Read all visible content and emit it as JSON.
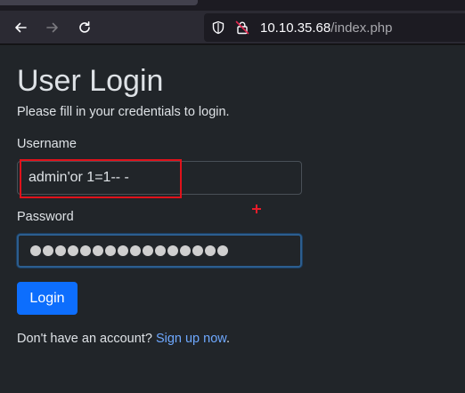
{
  "browser": {
    "url_host": "10.10.35.68",
    "url_path": "/index.php"
  },
  "page": {
    "title": "User Login",
    "subtitle": "Please fill in your credentials to login.",
    "username_label": "Username",
    "username_value": "admin'or 1=1-- -",
    "password_label": "Password",
    "password_masked_char_count": 16,
    "login_button": "Login",
    "footer_text": "Don't have an account? ",
    "signup_link": "Sign up now",
    "footer_end": "."
  },
  "annotations": {
    "highlight_color": "#e0121b",
    "cursor": "crosshair-icon"
  },
  "colors": {
    "accent": "#0d6efd",
    "link": "#6ea8fe",
    "background": "#212529"
  }
}
